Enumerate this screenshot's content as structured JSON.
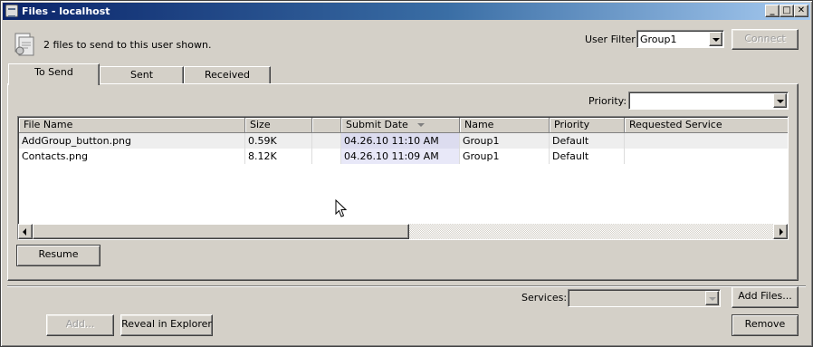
{
  "window": {
    "title": "Files - localhost",
    "controls": {
      "minimize": "_",
      "maximize": "□",
      "close": "✕"
    }
  },
  "header": {
    "status_text": "2 files to send to this user shown.",
    "user_filter_label": "User Filter:",
    "user_filter_value": "Group1",
    "connect_label": "Connect"
  },
  "tabs": [
    {
      "label": "To Send",
      "active": true
    },
    {
      "label": "Sent",
      "active": false
    },
    {
      "label": "Received",
      "active": false
    }
  ],
  "priority": {
    "label": "Priority:",
    "value": ""
  },
  "table": {
    "columns": [
      "File Name",
      "Size",
      "",
      "Submit Date",
      "Name",
      "Priority",
      "Requested Service"
    ],
    "sorted_column": "Submit Date",
    "rows": [
      [
        "AddGroup_button.png",
        "0.59K",
        "",
        "04.26.10 11:10 AM",
        "Group1",
        "Default",
        ""
      ],
      [
        "Contacts.png",
        "8.12K",
        "",
        "04.26.10 11:09 AM",
        "Group1",
        "Default",
        ""
      ]
    ]
  },
  "resume_label": "Resume",
  "services": {
    "label": "Services:",
    "value": ""
  },
  "footer": {
    "add_files_label": "Add Files...",
    "add_label": "Add...",
    "reveal_label": "Reveal in Explorer",
    "remove_label": "Remove"
  },
  "icons": {
    "app": "files-window-icon",
    "status": "file-transfer-icon"
  }
}
